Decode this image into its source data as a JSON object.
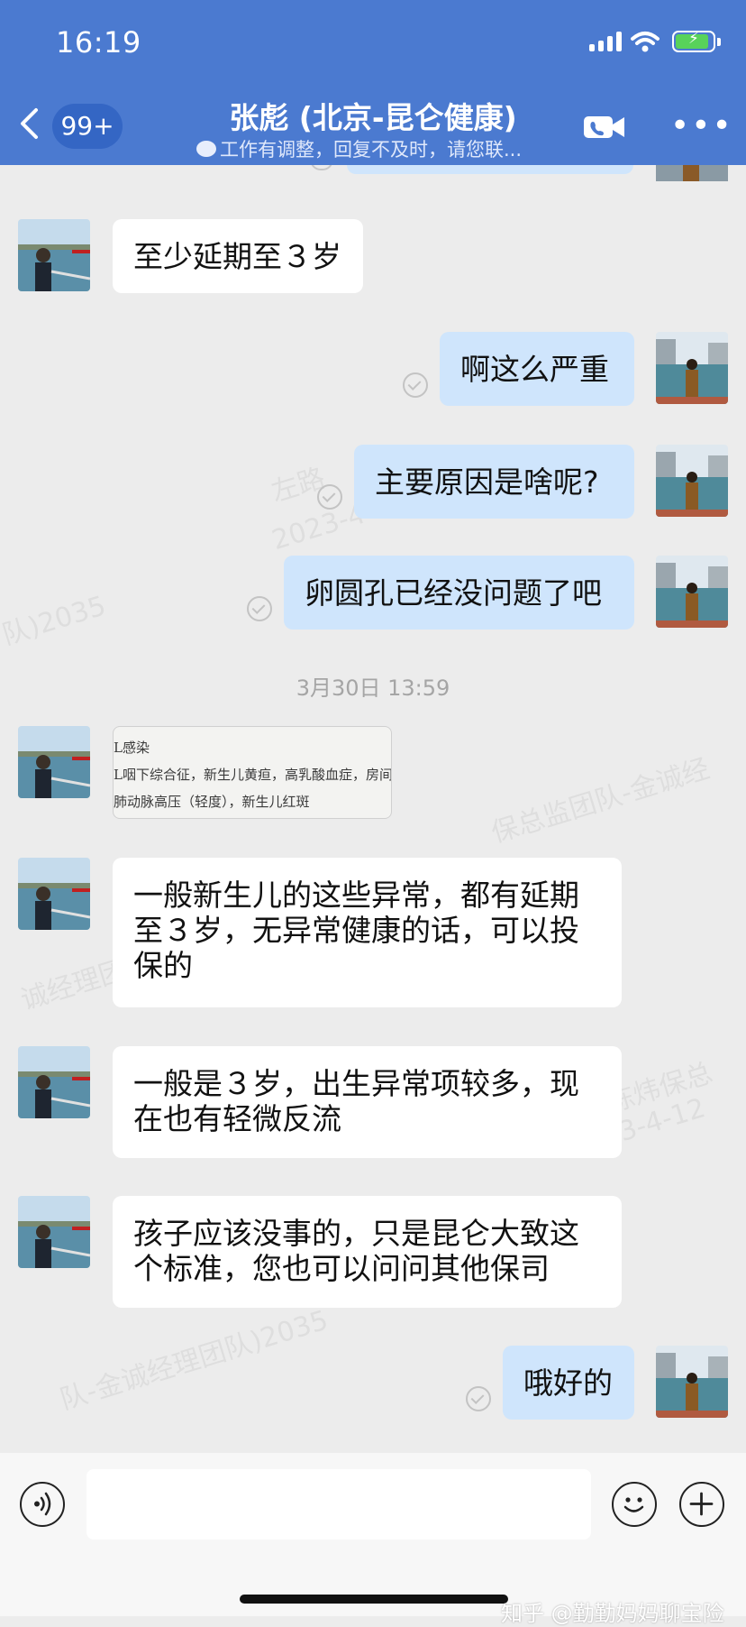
{
  "status_bar": {
    "time": "16:19"
  },
  "header": {
    "back_icon": "chevron-left-icon",
    "unread_count": "99+",
    "title": "张彪 (北京-昆仑健康)",
    "subtitle": "工作有调整，回复不及时，请您联...",
    "video_icon": "video-call-icon",
    "more_icon": "more-icon",
    "colors": {
      "background": "#4b7ad0",
      "badge": "#3466c4"
    }
  },
  "messages": [
    {
      "sender": "contact",
      "text": "至少延期至３岁"
    },
    {
      "sender": "me",
      "text": "啊这么严重"
    },
    {
      "sender": "me",
      "text": "主要原因是啥呢?"
    },
    {
      "sender": "me",
      "text": "卵圆孔已经没问题了吧"
    },
    {
      "sender": "contact",
      "text": "一般新生儿的这些异常，都有延期至３岁，无异常健康的话，可以投保的"
    },
    {
      "sender": "contact",
      "text": "一般是３岁，出生异常项较多，现在也有轻微反流"
    },
    {
      "sender": "contact",
      "text": "孩子应该没事的，只是昆仑大致这个标准，您也可以问问其他保司"
    },
    {
      "sender": "me",
      "text": "哦好的"
    }
  ],
  "timestamp": "3月30日 13:59",
  "image_message": {
    "lines": [
      "L感染",
      "L咽下综合征，新生儿黄疸，高乳酸血症，房间",
      "肺动脉高压（轻度），新生儿红斑"
    ]
  },
  "watermarks": {
    "w1": "左路",
    "w2": "2023-4-1",
    "w3": "队)2035",
    "w4": "保总监团队-金诚经",
    "w5": "诚经理团队",
    "w6": "(陈炜保总",
    "w7": "2023-4-12",
    "w8": "队-金诚经理团队)2035"
  },
  "input_bar": {
    "voice_icon": "voice-icon",
    "emoji_icon": "emoji-icon",
    "plus_icon": "plus-icon",
    "input_value": ""
  },
  "source_watermark": "知乎 @勤勤妈妈聊宝险",
  "colors": {
    "chat_background": "#ececec",
    "my_bubble": "#cfe5fc",
    "contact_bubble": "#ffffff"
  }
}
